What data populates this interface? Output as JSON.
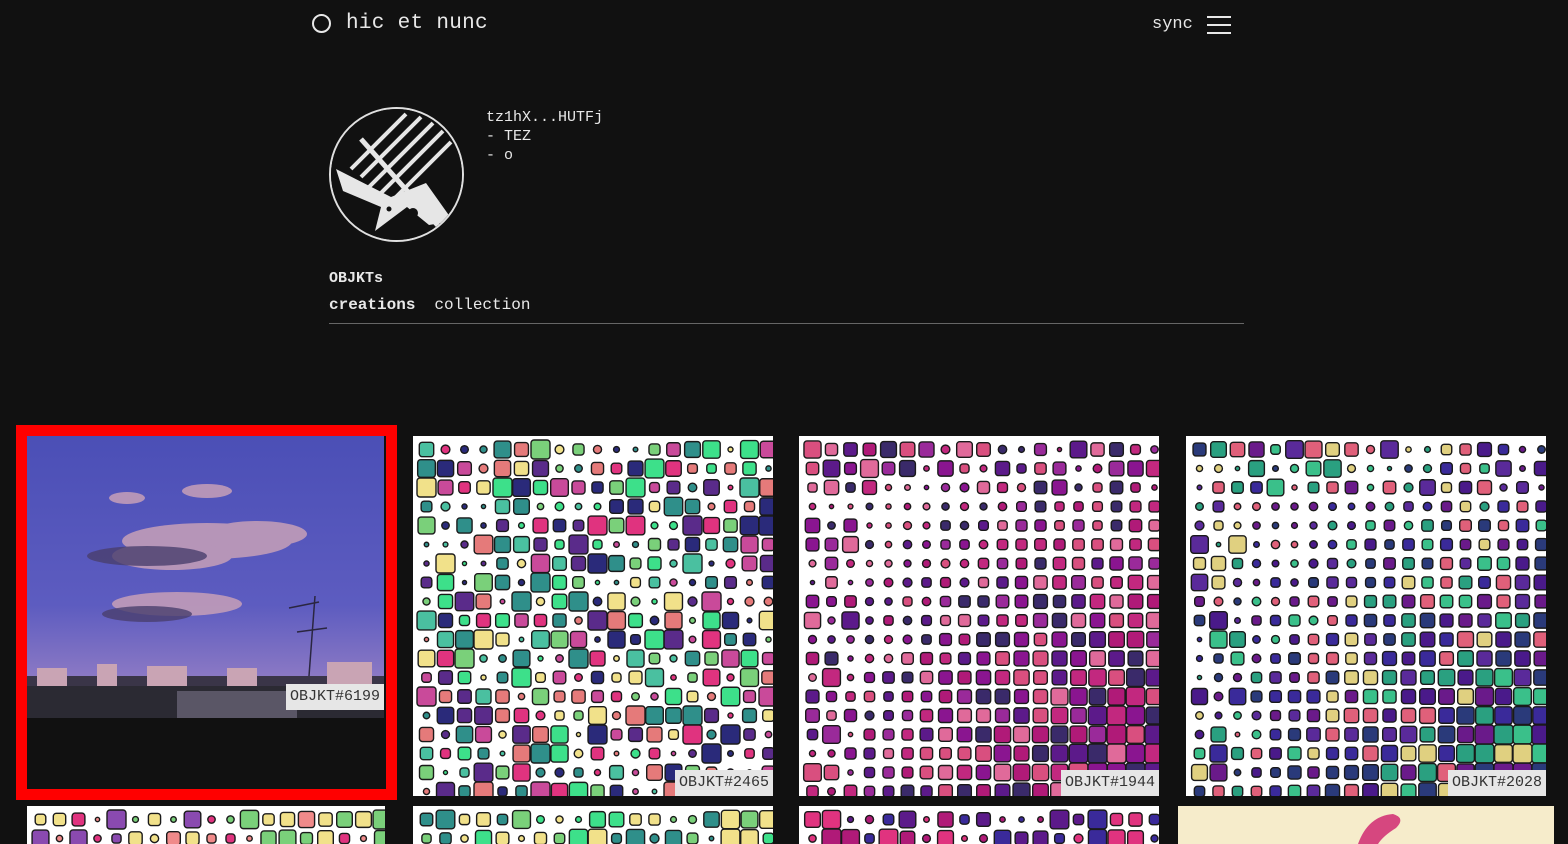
{
  "header": {
    "logo_text": "hic et nunc",
    "sync_label": "sync"
  },
  "profile": {
    "address": "tz1hX...HUTFj",
    "line2": "- TEZ",
    "line3": "- o"
  },
  "section": {
    "title": "OBJKTs",
    "tabs": [
      "creations",
      "collection"
    ],
    "active_tab": "creations"
  },
  "gallery": {
    "items": [
      {
        "label": "OBJKT#6199",
        "kind": "photo-sunset-clouds",
        "selected": true
      },
      {
        "label": "OBJKT#2465",
        "kind": "generative-squares-green-pink"
      },
      {
        "label": "OBJKT#1944",
        "kind": "generative-squares-magenta"
      },
      {
        "label": "OBJKT#2028",
        "kind": "generative-squares-purple-green"
      }
    ]
  },
  "colors": {
    "background": "#111111",
    "text": "#e8e8e8",
    "selection": "#ff0000",
    "label_bg": "#e6e6e6"
  }
}
